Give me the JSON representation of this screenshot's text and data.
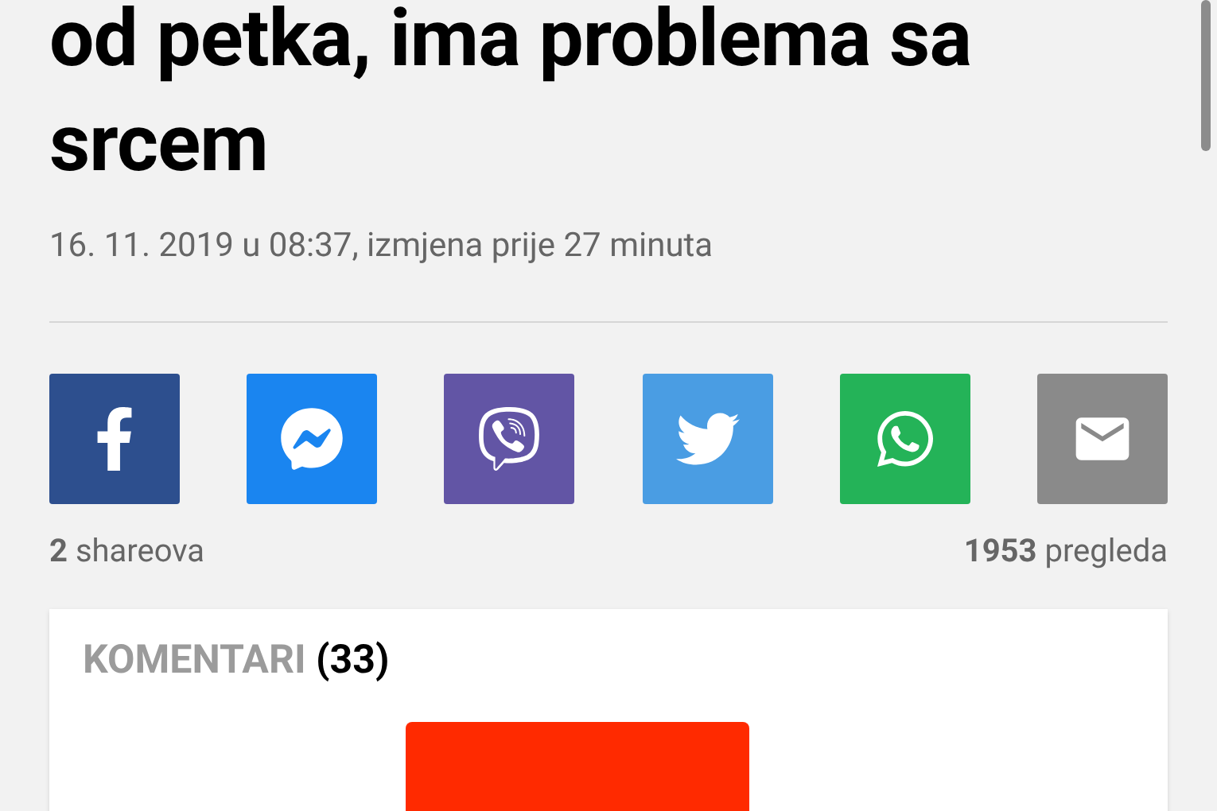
{
  "article": {
    "title": "od petka, ima problema sa srcem",
    "meta": "16. 11. 2019 u 08:37, izmjena prije 27 minuta"
  },
  "share_buttons": [
    {
      "kind": "facebook"
    },
    {
      "kind": "messenger"
    },
    {
      "kind": "viber"
    },
    {
      "kind": "twitter"
    },
    {
      "kind": "whatsapp"
    },
    {
      "kind": "email"
    }
  ],
  "stats": {
    "shares": "**2** shareova",
    "views": "**1953** pregleda"
  },
  "comments": {
    "label": "KOMENTARI",
    "count": "(33)"
  }
}
